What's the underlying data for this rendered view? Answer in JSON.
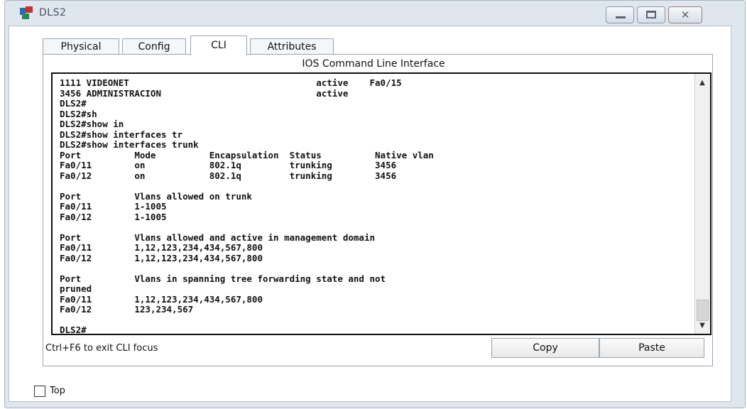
{
  "window": {
    "title": "DLS2",
    "icon": "network-device-icon",
    "controls": {
      "minimize": "minimize-icon",
      "maximize": "maximize-icon",
      "close": "✕"
    }
  },
  "tabs": [
    {
      "label": "Physical",
      "active": false
    },
    {
      "label": "Config",
      "active": false
    },
    {
      "label": "CLI",
      "active": true
    },
    {
      "label": "Attributes",
      "active": false
    }
  ],
  "panel": {
    "title": "IOS Command Line Interface",
    "console_lines": [
      "1111 VIDEONET                                   active    Fa0/15",
      "3456 ADMINISTRACION                             active",
      "DLS2#",
      "DLS2#sh",
      "DLS2#show in",
      "DLS2#show interfaces tr",
      "DLS2#show interfaces trunk",
      "Port          Mode          Encapsulation  Status          Native vlan",
      "Fa0/11        on            802.1q         trunking        3456",
      "Fa0/12        on            802.1q         trunking        3456",
      "",
      "Port          Vlans allowed on trunk",
      "Fa0/11        1-1005",
      "Fa0/12        1-1005",
      "",
      "Port          Vlans allowed and active in management domain",
      "Fa0/11        1,12,123,234,434,567,800",
      "Fa0/12        1,12,123,234,434,567,800",
      "",
      "Port          Vlans in spanning tree forwarding state and not",
      "pruned",
      "Fa0/11        1,12,123,234,434,567,800",
      "Fa0/12        123,234,567",
      "",
      "DLS2#"
    ],
    "hint": "Ctrl+F6 to exit CLI focus",
    "copy_label": "Copy",
    "paste_label": "Paste"
  },
  "footer": {
    "top_label": "Top",
    "top_checked": false
  }
}
